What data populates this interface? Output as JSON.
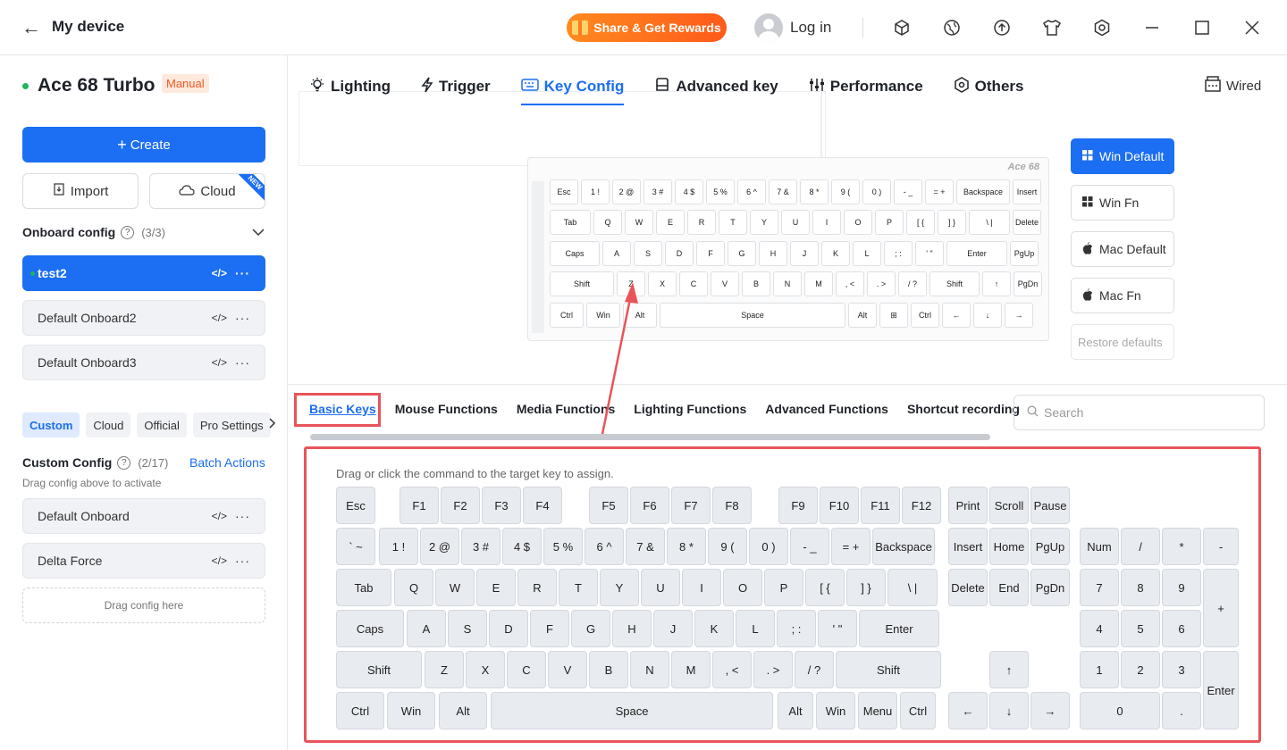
{
  "app": {
    "title": "My device",
    "share_label": "Share & Get Rewards",
    "login_label": "Log in"
  },
  "sidebar": {
    "device_name": "Ace 68 Turbo",
    "manual_badge": "Manual",
    "create_label": "Create",
    "import_label": "Import",
    "cloud_label": "Cloud",
    "new_badge": "NEW",
    "onboard_title": "Onboard config",
    "onboard_count": "(3/3)",
    "onboard_items": [
      "test2",
      "Default Onboard2",
      "Default Onboard3"
    ],
    "tabs": [
      "Custom",
      "Cloud",
      "Official",
      "Pro Settings"
    ],
    "custom_title": "Custom Config",
    "custom_count": "(2/17)",
    "batch_label": "Batch Actions",
    "drag_hint": "Drag config above to activate",
    "custom_items": [
      "Default Onboard",
      "Delta Force"
    ],
    "drag_here": "Drag config here"
  },
  "main_tabs": [
    "Lighting",
    "Trigger",
    "Key Config",
    "Advanced key",
    "Performance",
    "Others"
  ],
  "connection": "Wired",
  "preview": {
    "brand": "Ace 68"
  },
  "layers": [
    "Win Default",
    "Win Fn",
    "Mac Default",
    "Mac Fn",
    "Restore defaults"
  ],
  "categories": [
    "Basic Keys",
    "Mouse Functions",
    "Media Functions",
    "Lighting Functions",
    "Advanced Functions",
    "Shortcut recording"
  ],
  "search_placeholder": "Search",
  "assign_hint": "Drag or click the command to the target key to assign.",
  "colors": {
    "accent": "#1c6ef2",
    "highlight": "#e8545a",
    "brand_orange": "#ff7a1a"
  }
}
